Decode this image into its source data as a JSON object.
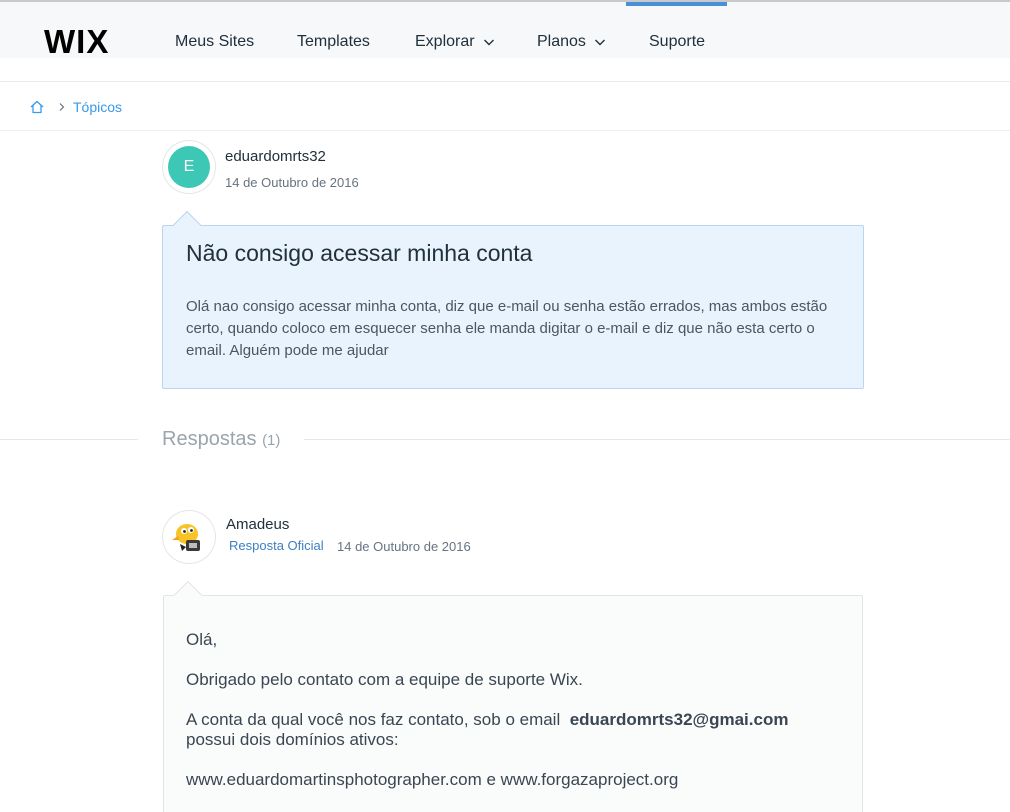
{
  "header": {
    "logo": "WIX",
    "nav": [
      {
        "label": "Meus Sites",
        "has_dropdown": false
      },
      {
        "label": "Templates",
        "has_dropdown": false
      },
      {
        "label": "Explorar",
        "has_dropdown": true
      },
      {
        "label": "Planos",
        "has_dropdown": true
      },
      {
        "label": "Suporte",
        "has_dropdown": false,
        "active": true
      }
    ],
    "accent_color": "#4a90d9"
  },
  "breadcrumb": {
    "home_icon": "home-icon",
    "items": [
      "Tópicos"
    ]
  },
  "question": {
    "author": {
      "initial": "E",
      "name": "eduardomrts32",
      "avatar_color": "#3cc8b4"
    },
    "date": "14 de Outubro de 2016",
    "title": "Não consigo acessar minha conta",
    "body": "Olá nao consigo acessar minha conta, diz que e-mail ou senha estão errados, mas ambos estão certo, quando coloco em esquecer senha ele manda digitar o e-mail e diz que não esta certo o email. Alguém pode me ajudar"
  },
  "responses": {
    "label": "Respostas",
    "count": "(1)"
  },
  "reply": {
    "author": {
      "name": "Amadeus",
      "avatar_icon": "amadeus-mascot-icon"
    },
    "badge": "Resposta Oficial",
    "date": "14 de Outubro de 2016",
    "greeting": "Olá,",
    "line1": "Obrigado pelo contato com a equipe de suporte Wix.",
    "line2_prefix": "A conta da qual você nos faz contato, sob o email",
    "email": "eduardomrts32@gmai.com",
    "line2_suffix": "possui dois domínios ativos:",
    "domains": "www.eduardomartinsphotographer.com e www.forgazaproject.org"
  }
}
